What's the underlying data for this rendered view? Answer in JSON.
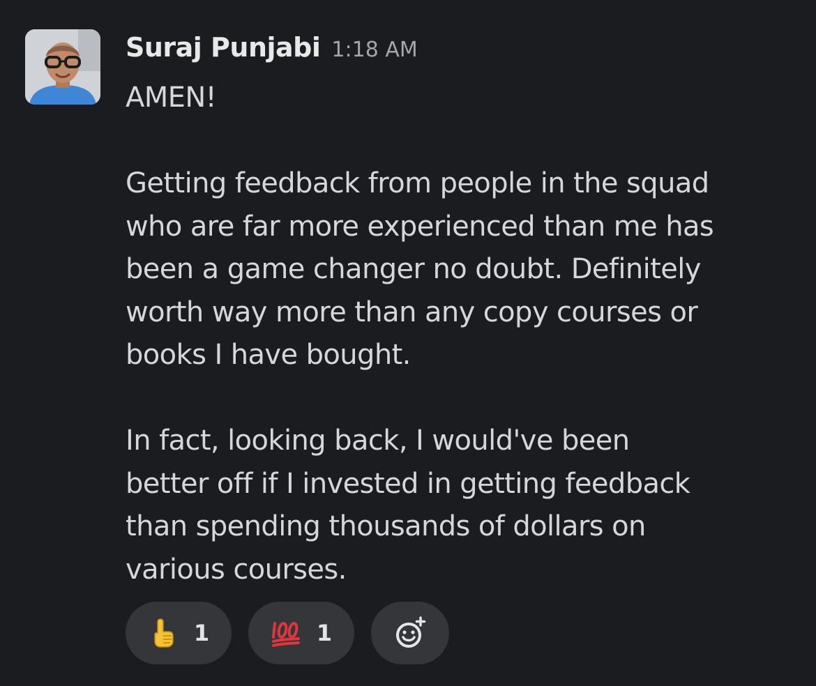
{
  "message": {
    "author": "Suraj Punjabi",
    "time": "1:18 AM",
    "paragraphs": [
      "AMEN!",
      "Getting feedback from people in the squad who are far more experienced than me has been a game changer no doubt. Definitely worth way more than any copy courses or books I have bought.",
      "In fact, looking back, I would've been better off if I invested in getting feedback than spending thousands of dollars on various courses."
    ],
    "paragraph_lines": [
      [
        "AMEN!"
      ],
      [
        "Getting feedback from people in the squad",
        "who are far more experienced than me has",
        "been a game changer no doubt. Definitely",
        "worth way more than any copy courses or",
        "books I have bought."
      ],
      [
        "In fact, looking back, I would've been",
        "better off if I invested in getting feedback",
        "than spending thousands of dollars on",
        "various courses."
      ]
    ]
  },
  "reactions": [
    {
      "icon": "point-up-emoji-icon",
      "count": "1"
    },
    {
      "icon": "hundred-points-emoji-icon",
      "count": "1"
    }
  ],
  "add_reaction": {
    "icon": "add-reaction-icon"
  },
  "colors": {
    "background": "#1b1c20",
    "pill": "#35363a",
    "text": "#d6d7d8",
    "timestamp": "#a5a6a9"
  }
}
